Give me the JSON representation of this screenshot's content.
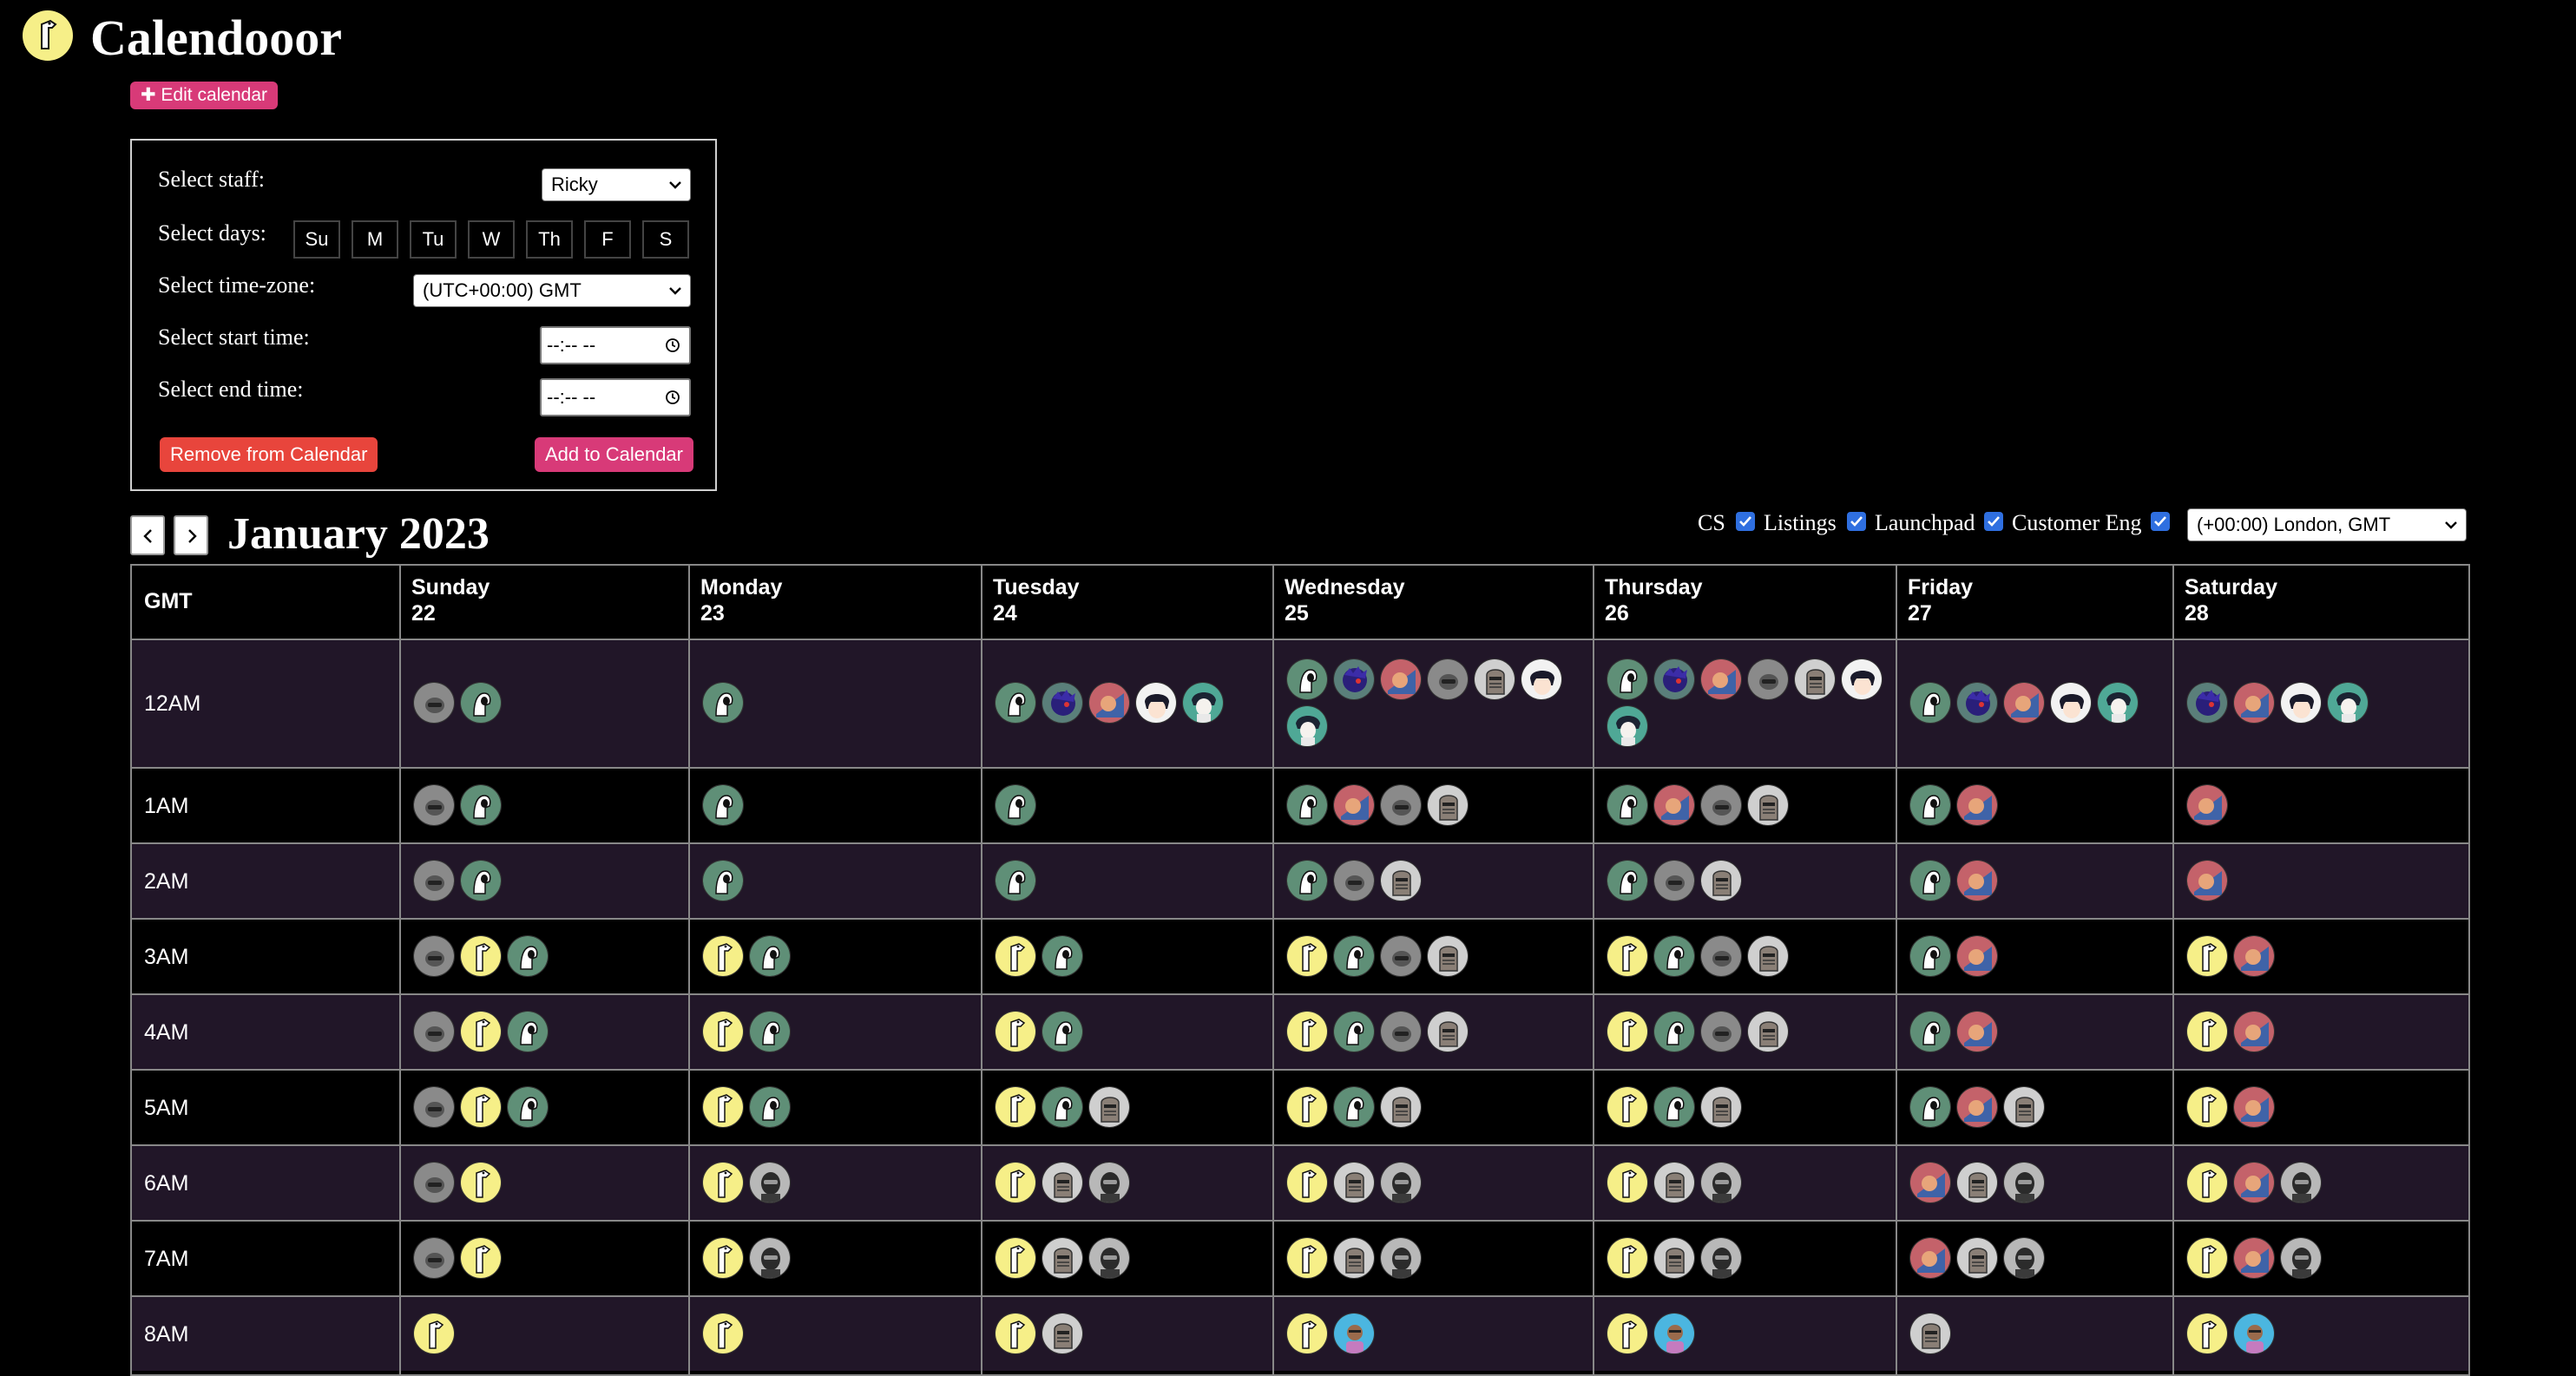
{
  "app": {
    "title": "Calendooor"
  },
  "edit_button": {
    "label": "✚ Edit calendar"
  },
  "panel": {
    "staff_label": "Select staff:",
    "staff_value": "Ricky",
    "days_label": "Select days:",
    "days": [
      "Su",
      "M",
      "Tu",
      "W",
      "Th",
      "F",
      "S"
    ],
    "timezone_label": "Select time-zone:",
    "timezone_value": "(UTC+00:00) GMT",
    "start_label": "Select start time:",
    "end_label": "Select end time:",
    "time_placeholder": "--:-- --",
    "remove_label": "Remove from Calendar",
    "add_label": "Add to Calendar"
  },
  "calendar": {
    "month": "January 2023",
    "filters": [
      "CS",
      "Listings",
      "Launchpad",
      "Customer Eng"
    ],
    "display_timezone": "(+00:00) London, GMT",
    "timezone_header": "GMT",
    "days": [
      {
        "name": "Sunday",
        "date": "22"
      },
      {
        "name": "Monday",
        "date": "23"
      },
      {
        "name": "Tuesday",
        "date": "24"
      },
      {
        "name": "Wednesday",
        "date": "25"
      },
      {
        "name": "Thursday",
        "date": "26"
      },
      {
        "name": "Friday",
        "date": "27"
      },
      {
        "name": "Saturday",
        "date": "28"
      }
    ],
    "hours": [
      "12AM",
      "1AM",
      "2AM",
      "3AM",
      "4AM",
      "5AM",
      "6AM",
      "7AM",
      "8AM"
    ],
    "slots": [
      [
        [
          "gray",
          "green"
        ],
        [
          "green"
        ],
        [
          "green",
          "purple",
          "pink",
          "anime",
          "teal"
        ],
        [
          "green",
          "purple",
          "pink",
          "gray",
          "knight",
          "anime",
          "teal"
        ],
        [
          "green",
          "purple",
          "pink",
          "gray",
          "knight",
          "anime",
          "teal"
        ],
        [
          "green",
          "purple",
          "pink",
          "anime",
          "teal"
        ],
        [
          "purple",
          "pink",
          "anime",
          "teal"
        ]
      ],
      [
        [
          "gray",
          "green"
        ],
        [
          "green"
        ],
        [
          "green"
        ],
        [
          "green",
          "pink",
          "gray",
          "knight"
        ],
        [
          "green",
          "pink",
          "gray",
          "knight"
        ],
        [
          "green",
          "pink"
        ],
        [
          "pink"
        ]
      ],
      [
        [
          "gray",
          "green"
        ],
        [
          "green"
        ],
        [
          "green"
        ],
        [
          "green",
          "gray",
          "knight"
        ],
        [
          "green",
          "gray",
          "knight"
        ],
        [
          "green",
          "pink"
        ],
        [
          "pink"
        ]
      ],
      [
        [
          "gray",
          "yellow",
          "green"
        ],
        [
          "yellow",
          "green"
        ],
        [
          "yellow",
          "green"
        ],
        [
          "yellow",
          "green",
          "gray",
          "knight"
        ],
        [
          "yellow",
          "green",
          "gray",
          "knight"
        ],
        [
          "green",
          "pink"
        ],
        [
          "yellow",
          "pink"
        ]
      ],
      [
        [
          "gray",
          "yellow",
          "green"
        ],
        [
          "yellow",
          "green"
        ],
        [
          "yellow",
          "green"
        ],
        [
          "yellow",
          "green",
          "gray",
          "knight"
        ],
        [
          "yellow",
          "green",
          "gray",
          "knight"
        ],
        [
          "green",
          "pink"
        ],
        [
          "yellow",
          "pink"
        ]
      ],
      [
        [
          "gray",
          "yellow",
          "green"
        ],
        [
          "yellow",
          "green"
        ],
        [
          "yellow",
          "green",
          "knight"
        ],
        [
          "yellow",
          "green",
          "knight"
        ],
        [
          "yellow",
          "green",
          "knight"
        ],
        [
          "green",
          "pink",
          "knight"
        ],
        [
          "yellow",
          "pink"
        ]
      ],
      [
        [
          "gray",
          "yellow"
        ],
        [
          "yellow",
          "silver"
        ],
        [
          "yellow",
          "knight",
          "silver"
        ],
        [
          "yellow",
          "knight",
          "silver"
        ],
        [
          "yellow",
          "knight",
          "silver"
        ],
        [
          "pink",
          "knight",
          "silver"
        ],
        [
          "yellow",
          "pink",
          "silver"
        ]
      ],
      [
        [
          "gray",
          "yellow"
        ],
        [
          "yellow",
          "silver"
        ],
        [
          "yellow",
          "knight",
          "silver"
        ],
        [
          "yellow",
          "knight",
          "silver"
        ],
        [
          "yellow",
          "knight",
          "silver"
        ],
        [
          "pink",
          "knight",
          "silver"
        ],
        [
          "yellow",
          "pink",
          "silver"
        ]
      ],
      [
        [
          "yellow"
        ],
        [
          "yellow"
        ],
        [
          "yellow",
          "knight"
        ],
        [
          "yellow",
          "blue"
        ],
        [
          "yellow",
          "blue"
        ],
        [
          "knight"
        ],
        [
          "yellow",
          "blue"
        ]
      ]
    ]
  },
  "colors": {
    "accent_pink": "#d83a78",
    "danger_red": "#e8453c",
    "row_alt": "#211628",
    "checkbox_blue": "#2f6fe0"
  },
  "icons": {
    "logo": "llama-icon",
    "prev": "chevron-left-icon",
    "next": "chevron-right-icon",
    "dropdown": "chevron-down-icon",
    "clock": "clock-icon",
    "checkbox": "check-icon"
  }
}
